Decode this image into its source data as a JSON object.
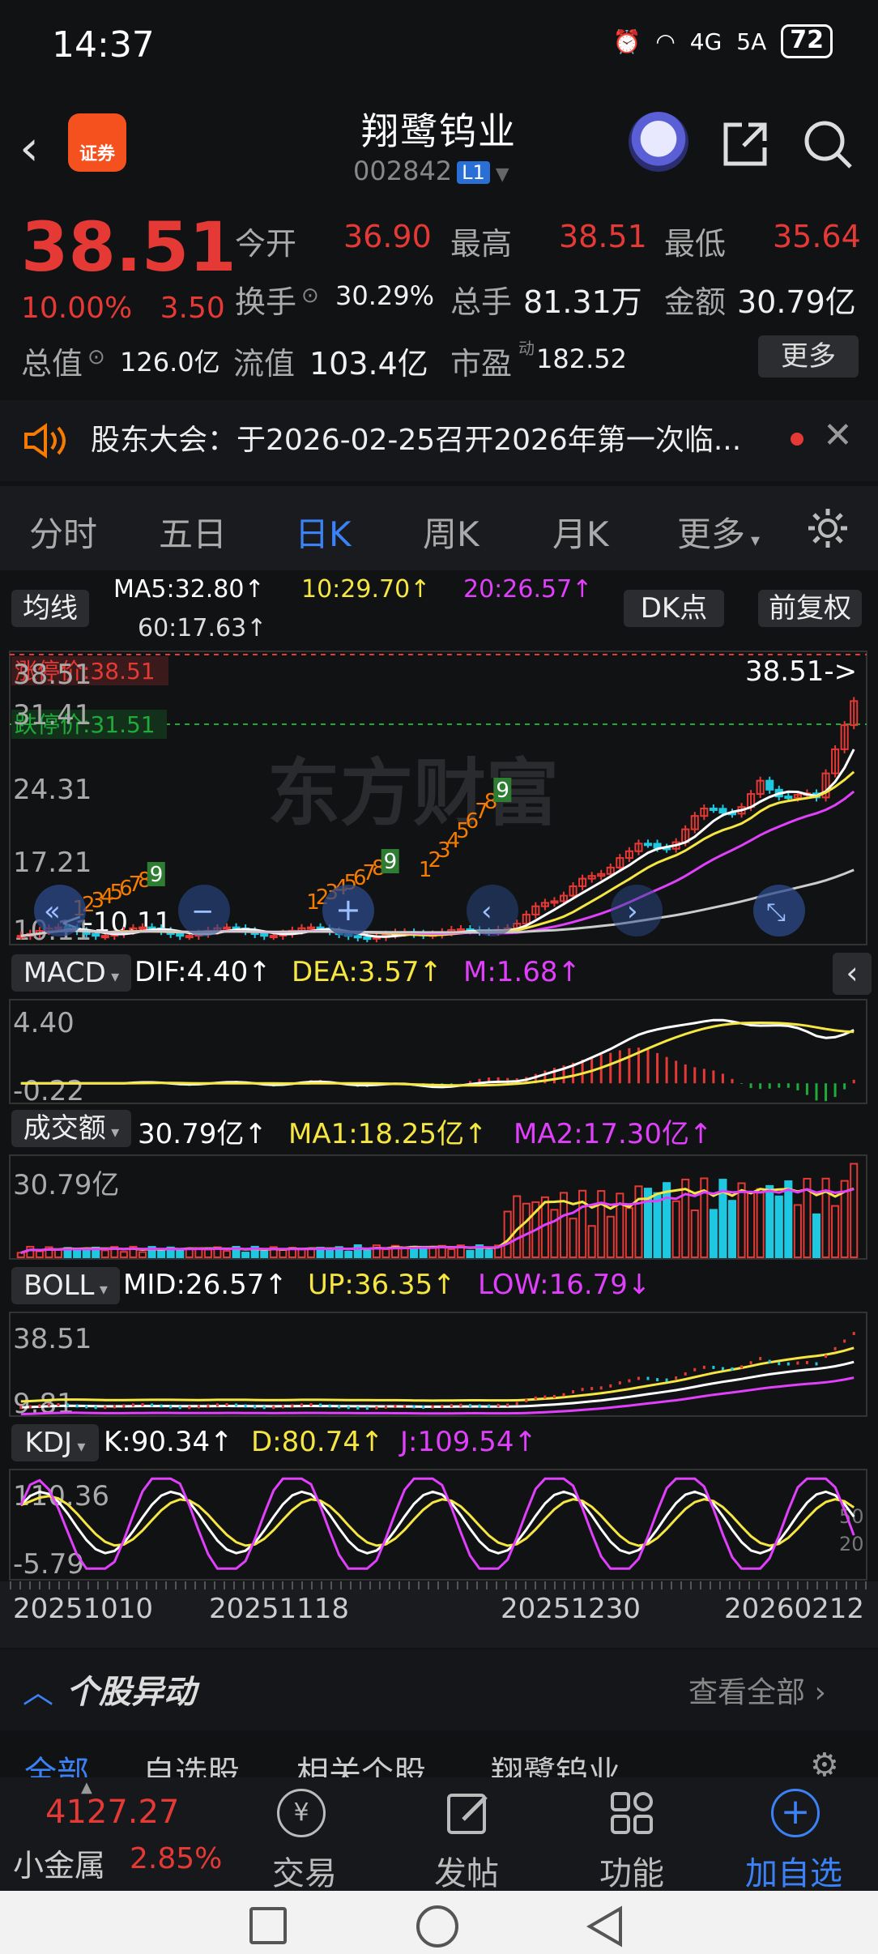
{
  "status_bar": {
    "time": "14:37",
    "network1": "4G",
    "network2": "5A",
    "battery": "72"
  },
  "header": {
    "title": "翔鹭钨业",
    "code": "002842",
    "level_badge": "L1",
    "broker_logo_text": "证券"
  },
  "quote": {
    "price": "38.51",
    "change_pct": "10.00%",
    "change_amt": "3.50",
    "open_label": "今开",
    "open": "36.90",
    "high_label": "最高",
    "high": "38.51",
    "low_label": "最低",
    "low": "35.64",
    "turnover_label": "换手",
    "turnover": "30.29%",
    "volume_label": "总手",
    "volume": "81.31万",
    "amount_label": "金额",
    "amount": "30.79亿",
    "mktcap_label": "总值",
    "mktcap": "126.0亿",
    "float_label": "流值",
    "float_cap": "103.4亿",
    "pe_label": "市盈",
    "pe_sup": "动",
    "pe": "182.52",
    "more_label": "更多"
  },
  "notice": {
    "text": "股东大会：于2026-02-25召开2026年第一次临..."
  },
  "tabs": [
    "分时",
    "五日",
    "日K",
    "周K",
    "月K",
    "更多"
  ],
  "active_tab": "日K",
  "kline": {
    "indicator_label": "均线",
    "ma5": "MA5:32.80↑",
    "ma10": "10:29.70↑",
    "ma20": "20:26.57↑",
    "ma60": "60:17.63↑",
    "dk_label": "DK点",
    "adjust_label": "前复权",
    "y_labels": [
      "38.51",
      "31.41",
      "24.31",
      "17.21",
      "10.11"
    ],
    "limit_up_label": "涨停价:38.51",
    "limit_down_label": "跌停价:31.51",
    "last_price_marker": "38.51->",
    "min_marker": "<-10.11",
    "watermark": "东方财富",
    "td_counts_1": [
      "1",
      "2",
      "3",
      "4",
      "5",
      "6",
      "7",
      "8"
    ],
    "td_nine": "9"
  },
  "macd": {
    "label": "MACD",
    "dif": "DIF:4.40↑",
    "dea": "DEA:3.57↑",
    "m": "M:1.68↑",
    "y_top": "4.40",
    "y_bot": "-0.22"
  },
  "volume_panel": {
    "label": "成交额",
    "value": "30.79亿↑",
    "ma1": "MA1:18.25亿↑",
    "ma2": "MA2:17.30亿↑",
    "y_top": "30.79亿"
  },
  "boll": {
    "label": "BOLL",
    "mid": "MID:26.57↑",
    "up": "UP:36.35↑",
    "low": "LOW:16.79↓",
    "y_top": "38.51",
    "y_bot": "9.81"
  },
  "kdj": {
    "label": "KDJ",
    "k": "K:90.34↑",
    "d": "D:80.74↑",
    "j": "J:109.54↑",
    "y_top": "110.36",
    "y_bot": "-5.79",
    "ref1": "50",
    "ref2": "20"
  },
  "dates": [
    "20251010",
    "20251118",
    "20251230",
    "20260212"
  ],
  "section": {
    "title": "个股异动",
    "view_all": "查看全部"
  },
  "subtabs": [
    "全部",
    "自选股",
    "相关个股",
    "翔鹭钨业"
  ],
  "bottom_bar": {
    "index_value": "4127.27",
    "index_name": "小金属",
    "index_change": "2.85%",
    "items": [
      "交易",
      "发帖",
      "功能",
      "加自选"
    ]
  },
  "colors": {
    "up": "#e53935",
    "down": "#1ec8e0",
    "accent": "#3b82f6",
    "ma5": "#ffffff",
    "ma10": "#f5e642",
    "ma20": "#e040fb",
    "ma60": "#cccccc"
  }
}
